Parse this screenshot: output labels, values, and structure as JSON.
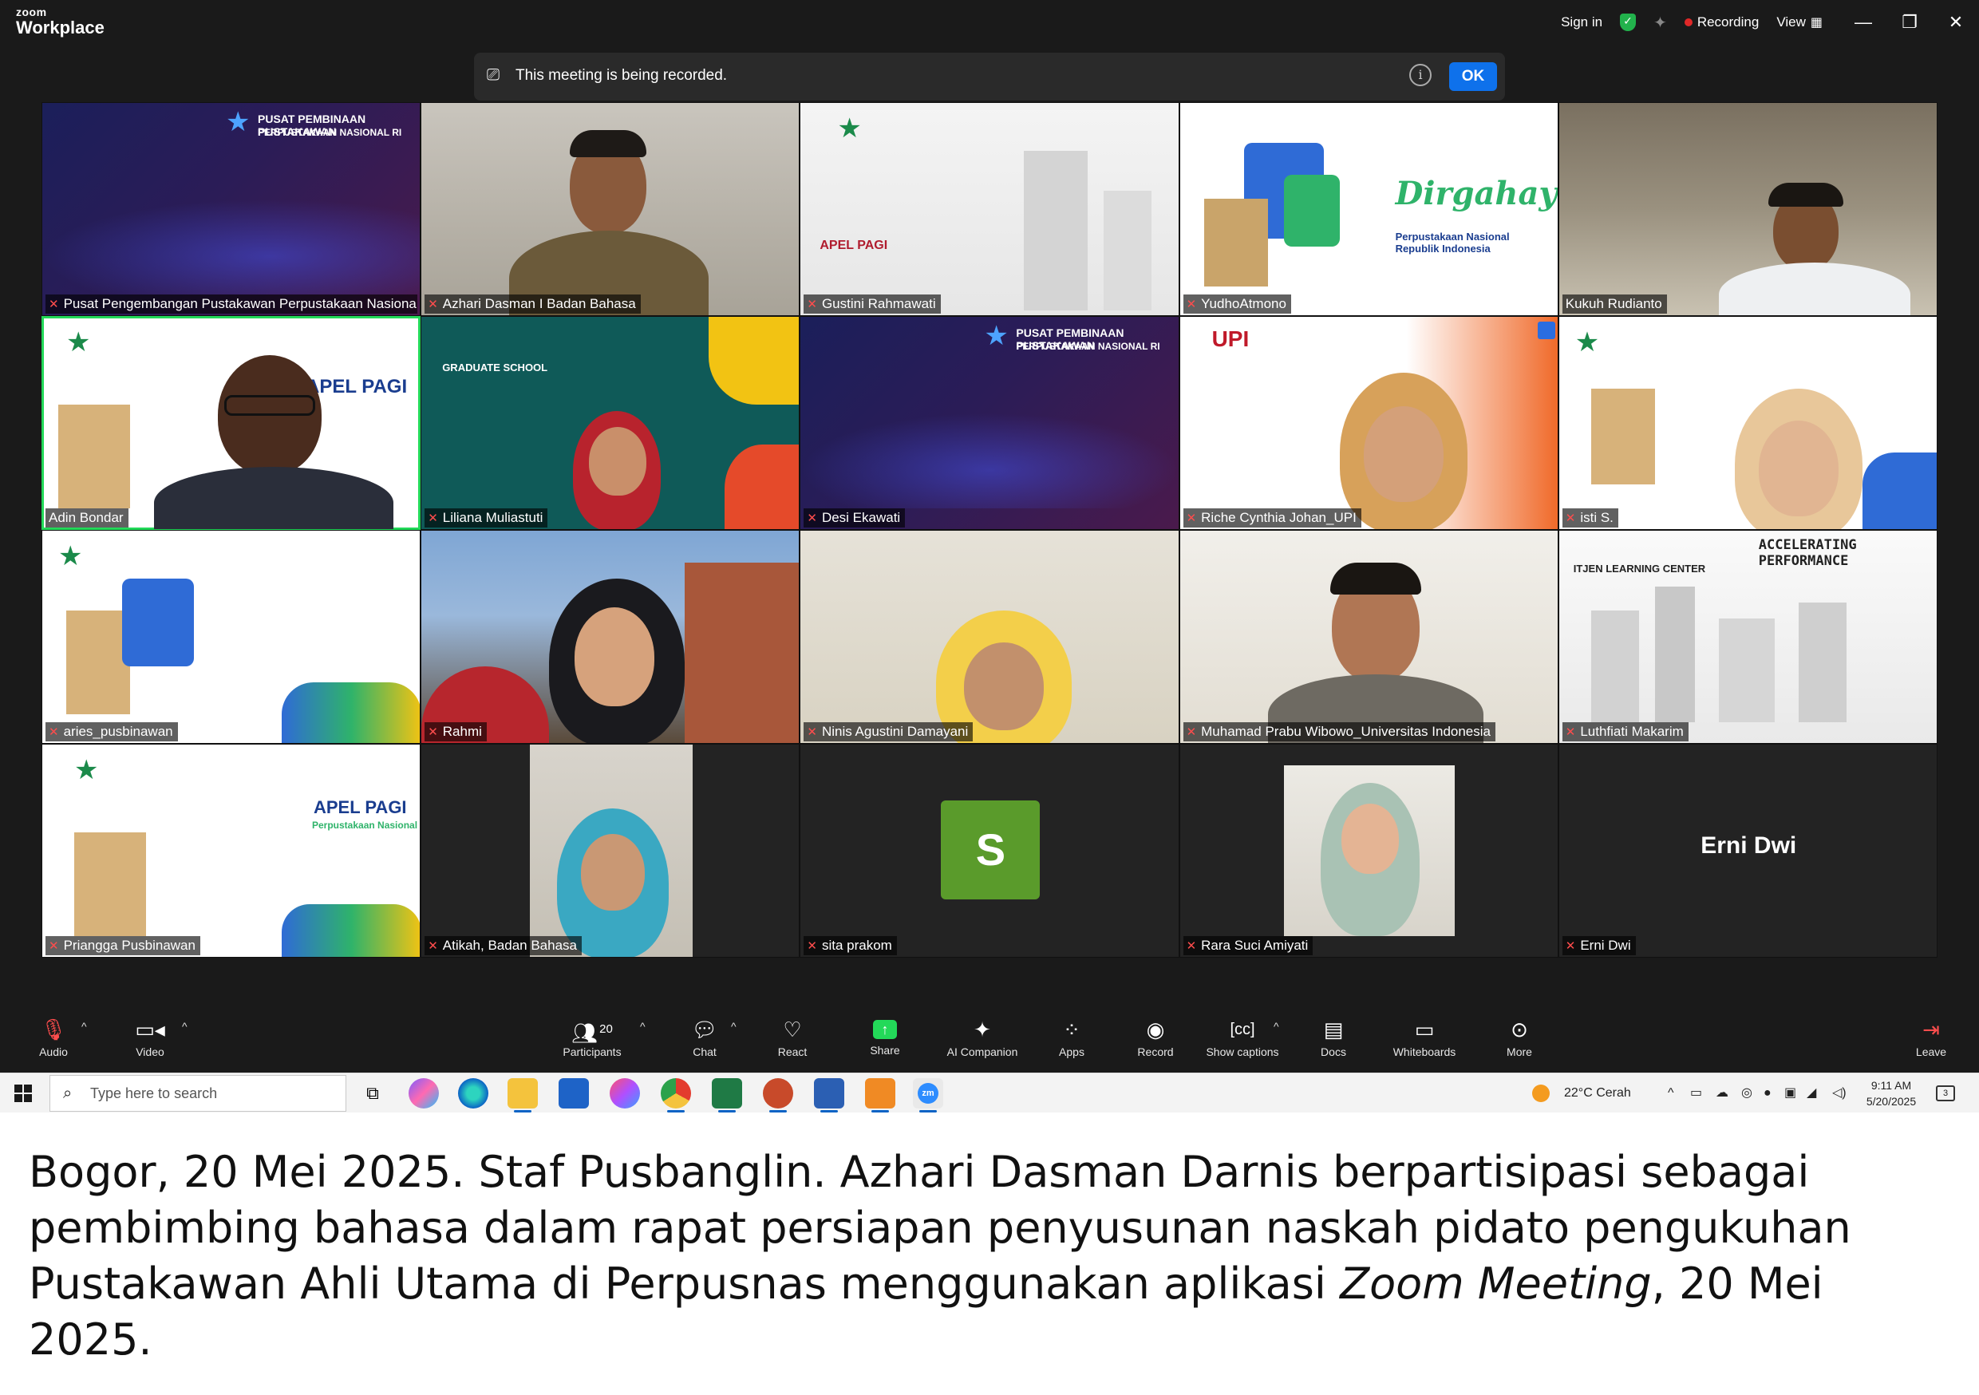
{
  "app": {
    "brand_top": "zoom",
    "brand_bottom": "Workplace"
  },
  "titlebar": {
    "sign_in": "Sign in",
    "recording": "Recording",
    "view": "View"
  },
  "banner": {
    "message": "This meeting is being recorded.",
    "ok": "OK"
  },
  "tiles": [
    {
      "name": "Pusat Pengembangan Pustakawan Perpustakaan Nasional..."
    },
    {
      "name": "Azhari Dasman I Badan Bahasa"
    },
    {
      "name": "Gustini Rahmawati"
    },
    {
      "name": "YudhoAtmono"
    },
    {
      "name": "Kukuh Rudianto"
    },
    {
      "name": "Adin Bondar"
    },
    {
      "name": "Liliana Muliastuti"
    },
    {
      "name": "Desi Ekawati"
    },
    {
      "name": "Riche Cynthia Johan_UPI"
    },
    {
      "name": "isti S."
    },
    {
      "name": "aries_pusbinawan"
    },
    {
      "name": "Rahmi"
    },
    {
      "name": "Ninis Agustini Damayani"
    },
    {
      "name": "Muhamad Prabu Wibowo_Universitas Indonesia"
    },
    {
      "name": "Luthfiati Makarim"
    },
    {
      "name": "Priangga Pusbinawan"
    },
    {
      "name": "Atikah, Badan Bahasa"
    },
    {
      "name": "sita prakom",
      "avatar_letter": "S"
    },
    {
      "name": "Rara Suci Amiyati"
    },
    {
      "name": "Erni Dwi",
      "display_name": "Erni Dwi"
    }
  ],
  "slides": {
    "pusat_title": "PUSAT PEMBINAAN PUSTAKAWAN",
    "pusat_sub": "PERPUSTAKAAN NASIONAL RI",
    "apel": "APEL PAGI",
    "apel_sub": "Perpustakaan Nasional",
    "dirgahayu": "Dirgahayu",
    "dirgahayu_sub": "Perpustakaan Nasional Republik Indonesia",
    "graduate": "GRADUATE SCHOOL",
    "upi": "UPI",
    "itjen": "ITJEN LEARNING CENTER",
    "accel": "ACCELERATING PERFORMANCE"
  },
  "toolbar": {
    "audio": "Audio",
    "video": "Video",
    "participants": "Participants",
    "participants_count": "20",
    "chat": "Chat",
    "react": "React",
    "share": "Share",
    "ai_companion": "AI Companion",
    "apps": "Apps",
    "record": "Record",
    "show_captions": "Show captions",
    "docs": "Docs",
    "whiteboards": "Whiteboards",
    "more": "More",
    "leave": "Leave"
  },
  "taskbar": {
    "search_placeholder": "Type here to search",
    "weather": "22°C  Cerah",
    "time": "9:11 AM",
    "date": "5/20/2025",
    "notifications": "3"
  },
  "caption": {
    "text": "Bogor, 20 Mei 2025. Staf Pusbanglin. Azhari Dasman Darnis berpartisipasi sebagai pembimbing bahasa dalam rapat persiapan penyusunan naskah pidato pengukuhan Pustakawan Ahli Utama di Perpusnas menggunakan aplikasi ",
    "italic": "Zoom Meeting",
    "tail": ", 20 Mei 2025."
  },
  "colors": {
    "accent": "#0e71eb",
    "active_speaker": "#23d959",
    "muted": "#ff4d4d",
    "avatar_green": "#5a9b2b"
  }
}
